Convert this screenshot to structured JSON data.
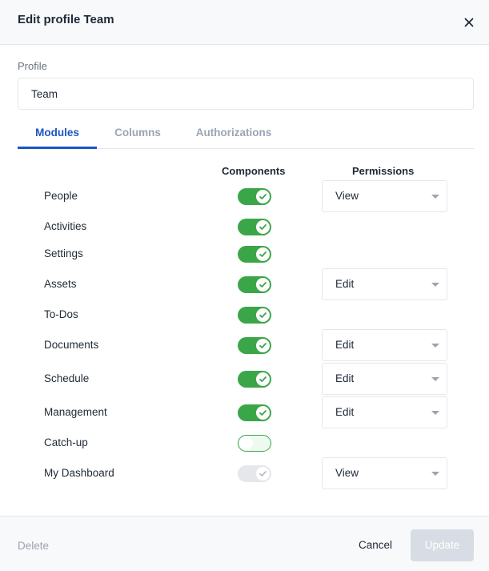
{
  "dialog": {
    "title": "Edit profile Team",
    "close_icon": "close-icon"
  },
  "profile": {
    "label": "Profile",
    "value": "Team"
  },
  "tabs": [
    {
      "label": "Modules",
      "active": true
    },
    {
      "label": "Columns",
      "active": false
    },
    {
      "label": "Authorizations",
      "active": false
    }
  ],
  "columns": {
    "components": "Components",
    "permissions": "Permissions"
  },
  "modules": [
    {
      "label": "People",
      "enabled": true,
      "disabled": false,
      "permission": "View"
    },
    {
      "label": "Activities",
      "enabled": true,
      "disabled": false,
      "permission": null
    },
    {
      "label": "Settings",
      "enabled": true,
      "disabled": false,
      "permission": null
    },
    {
      "label": "Assets",
      "enabled": true,
      "disabled": false,
      "permission": "Edit"
    },
    {
      "label": "To-Dos",
      "enabled": true,
      "disabled": false,
      "permission": null
    },
    {
      "label": "Documents",
      "enabled": true,
      "disabled": false,
      "permission": "Edit"
    },
    {
      "label": "Schedule",
      "enabled": true,
      "disabled": false,
      "permission": "Edit"
    },
    {
      "label": "Management",
      "enabled": true,
      "disabled": false,
      "permission": "Edit"
    },
    {
      "label": "Catch-up",
      "enabled": false,
      "disabled": false,
      "permission": null
    },
    {
      "label": "My Dashboard",
      "enabled": true,
      "disabled": true,
      "permission": "View"
    }
  ],
  "footer": {
    "delete_label": "Delete",
    "cancel_label": "Cancel",
    "update_label": "Update"
  },
  "colors": {
    "accent": "#1a56c4",
    "toggle_on": "#3aa648",
    "toggle_disabled": "#e5e7eb",
    "update_disabled": "#d8dde5"
  }
}
